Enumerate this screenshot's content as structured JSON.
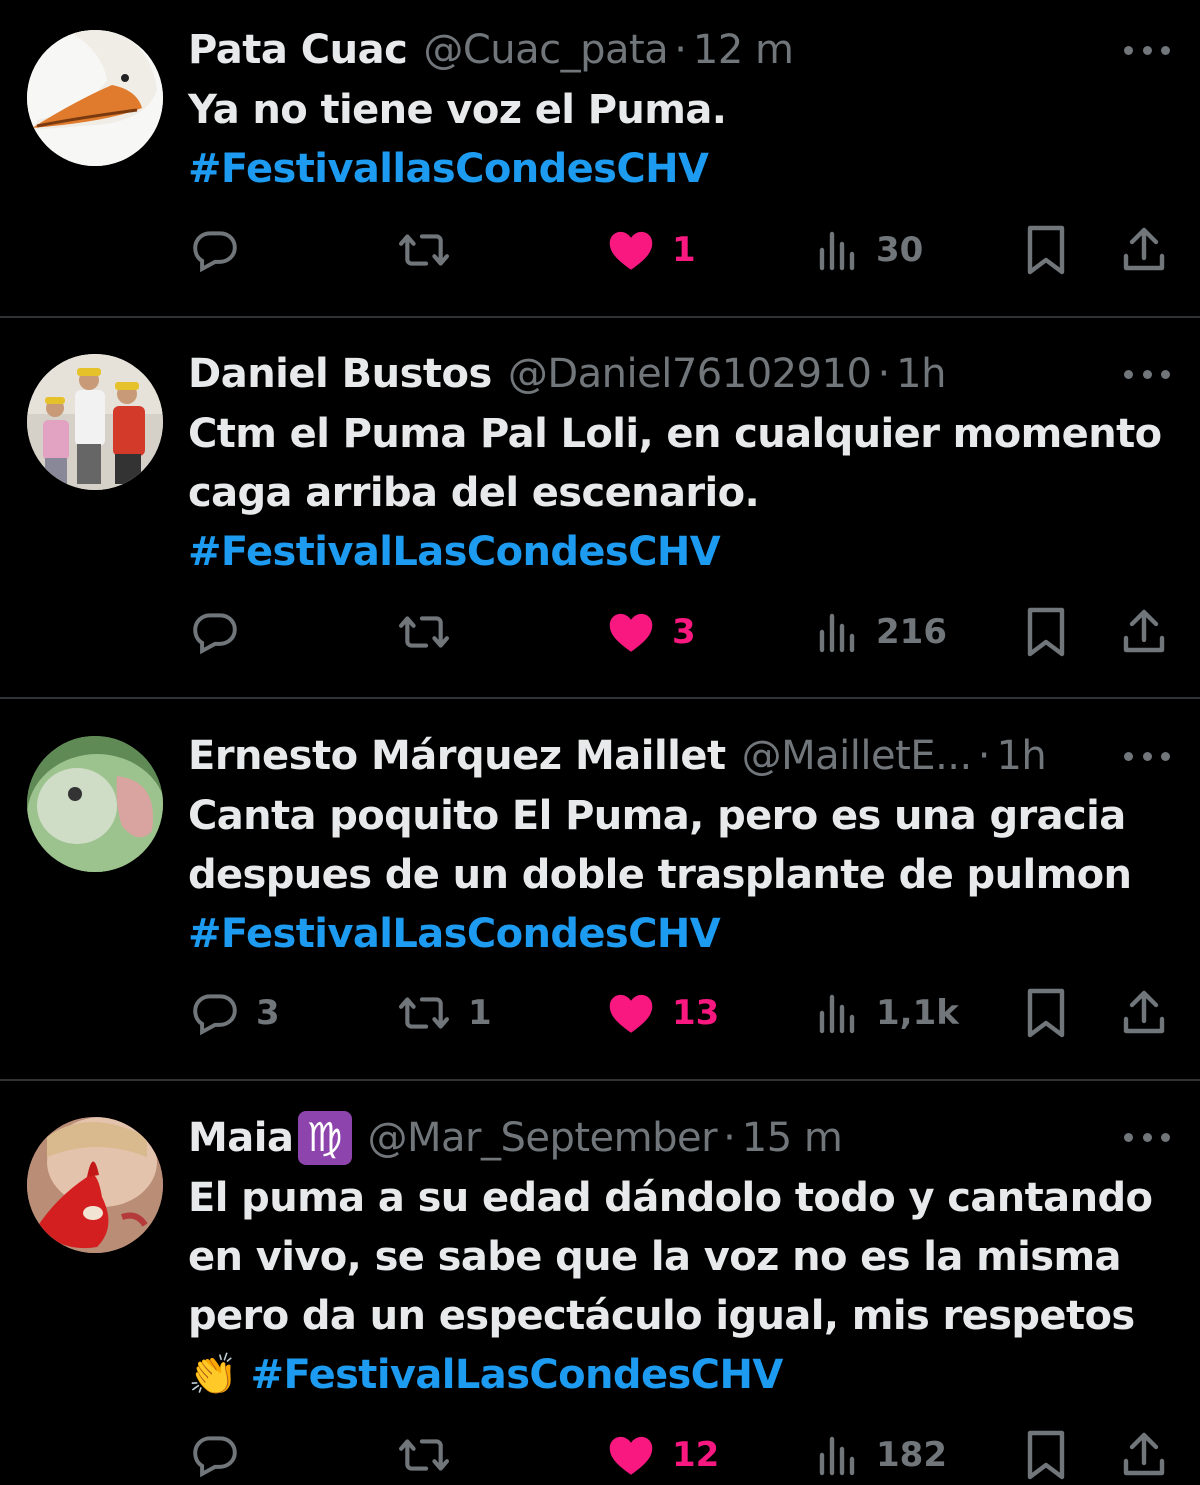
{
  "tweets": [
    {
      "name": "Pata Cuac",
      "handle": "@Cuac_pata",
      "time": "12 m",
      "lines": [
        "Ya no tiene voz el Puma."
      ],
      "hashtag": "#FestivallasCondesCHV",
      "replies": "",
      "retweets": "",
      "likes": "1",
      "views": "30"
    },
    {
      "name": "Daniel Bustos",
      "handle": "@Daniel76102910",
      "time": "1h",
      "lines": [
        "Ctm el Puma Pal Loli, en cualquier momento",
        "caga arriba del escenario."
      ],
      "hashtag": "#FestivalLasCondesCHV",
      "replies": "",
      "retweets": "",
      "likes": "3",
      "views": "216"
    },
    {
      "name": "Ernesto Márquez Maillet",
      "handle": "@MailletE...",
      "time": "1h",
      "lines": [
        "Canta poquito El Puma, pero es una gracia",
        "despues de un doble trasplante de pulmon"
      ],
      "hashtag": "#FestivalLasCondesCHV",
      "replies": "3",
      "retweets": "1",
      "likes": "13",
      "views": "1,1k"
    },
    {
      "name": "Maia",
      "badge": "♍",
      "handle": "@Mar_September",
      "time": "15 m",
      "lines": [
        "El puma a su edad dándolo todo y cantando",
        "en vivo, se sabe que la voz no es la misma",
        "pero da un espectáculo igual, mis respetos"
      ],
      "emoji": "👏",
      "hashtag": "#FestivalLasCondesCHV",
      "replies": "",
      "retweets": "",
      "likes": "12",
      "views": "182"
    }
  ],
  "dot": "·",
  "icons": [
    "reply-icon",
    "retweet-icon",
    "like-icon",
    "views-icon",
    "bookmark-icon",
    "share-icon",
    "more-icon"
  ],
  "colors": {
    "background": "#000000",
    "text": "#e7e9ea",
    "muted": "#71767b",
    "link": "#1d9bf0",
    "like": "#f91880",
    "divider": "#2f3336"
  }
}
